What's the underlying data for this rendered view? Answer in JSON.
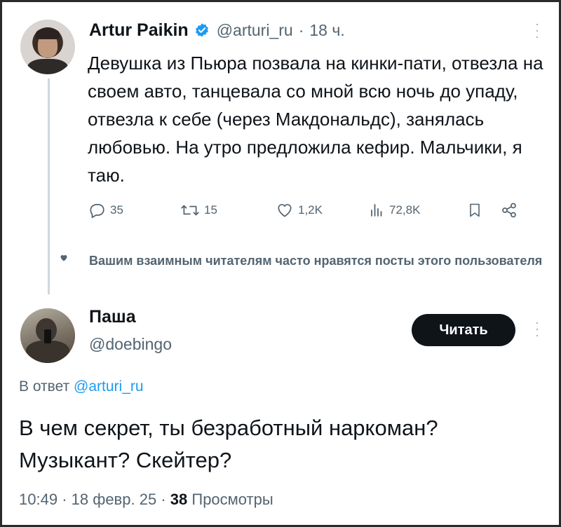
{
  "tweet": {
    "author": {
      "display_name": "Artur Paikin",
      "handle": "@arturi_ru",
      "time": "18 ч.",
      "verified": true
    },
    "text": "Девушка из Пьюра позвала на кинки-пати, отвезла на своем авто, танцевала со мной всю ночь до упаду, отвезла к себе (через Макдональдс), занялась любовью. На утро предложила кефир. Мальчики, я таю.",
    "actions": {
      "replies": "35",
      "retweets": "15",
      "likes": "1,2K",
      "views": "72,8K"
    }
  },
  "social_context": {
    "text": "Вашим взаимным читателям часто нравятся посты этого пользователя"
  },
  "reply": {
    "author": {
      "display_name": "Паша",
      "handle": "@doebingo"
    },
    "follow_label": "Читать",
    "in_reply_prefix": "В ответ",
    "in_reply_mention": "@arturi_ru",
    "text": "В чем секрет, ты безработный наркоман? Музыкант? Скейтер?",
    "time": "10:49",
    "date": "18 февр. 25",
    "views_count": "38",
    "views_label": "Просмотры"
  },
  "colors": {
    "text": "#0f1419",
    "secondary": "#536471",
    "accent": "#1d9bf0",
    "button_bg": "#0f1419"
  },
  "icons": [
    "verified-badge-icon",
    "reply-icon",
    "retweet-icon",
    "like-icon",
    "views-icon",
    "bookmark-icon",
    "share-icon",
    "more-icon",
    "heart-icon"
  ]
}
